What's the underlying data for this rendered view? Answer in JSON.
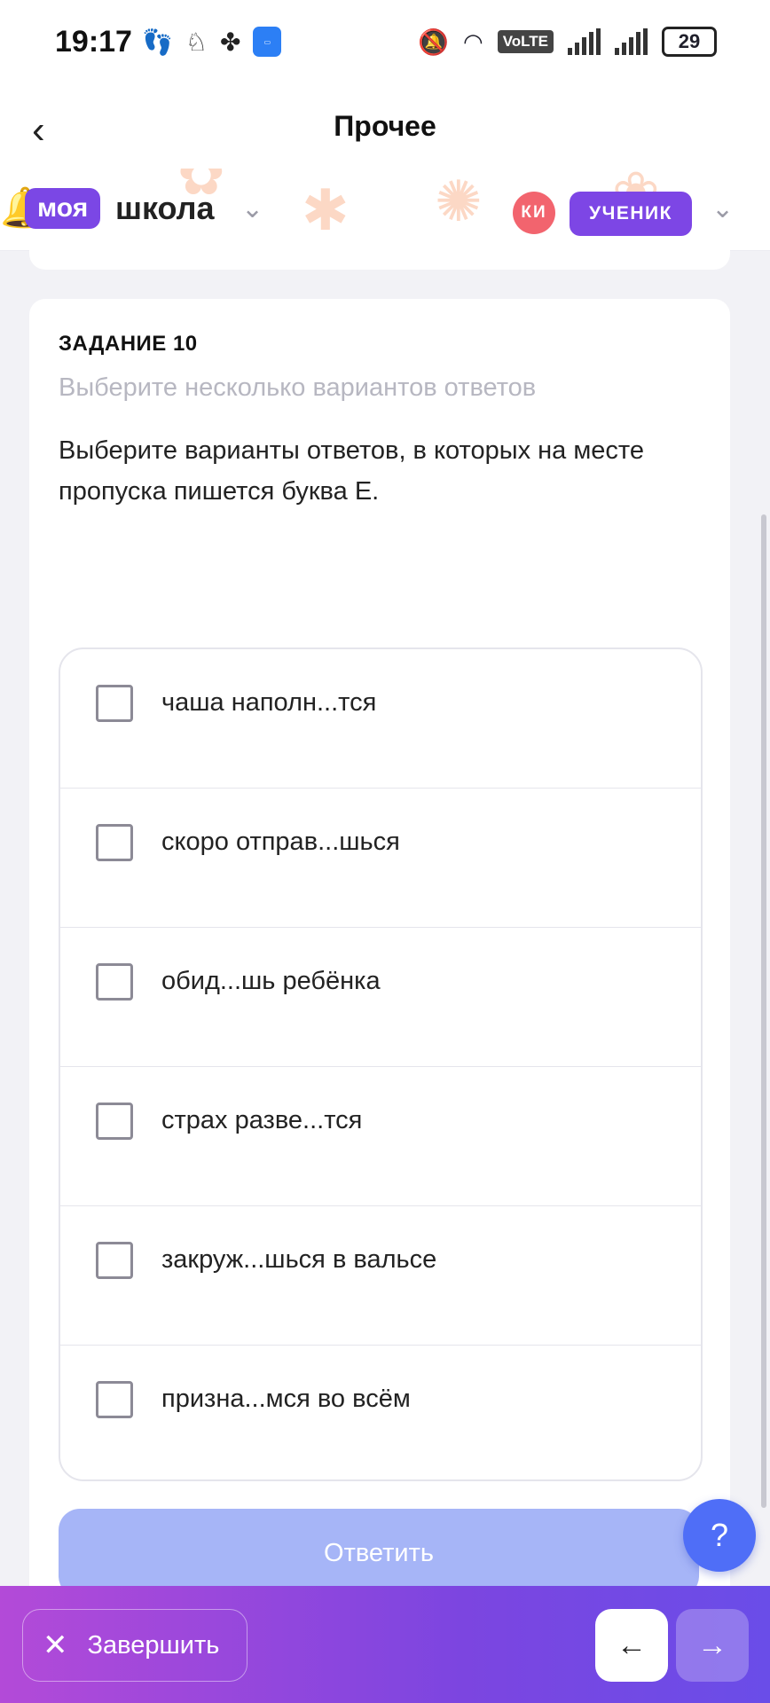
{
  "status": {
    "time": "19:17",
    "network": "VoLTE",
    "battery": "29"
  },
  "header": {
    "title": "Прочее"
  },
  "school": {
    "logo_part1": "моя",
    "logo_part2": "школа",
    "avatar_initials": "КИ",
    "role": "УЧЕНИК"
  },
  "task": {
    "label": "ЗАДАНИЕ 10",
    "hint": "Выберите несколько вариантов ответов",
    "question": "Выберите  варианты ответов, в которых на месте пропуска пишется буква Е.",
    "options": [
      {
        "text": "чаша наполн...тся",
        "checked": false
      },
      {
        "text": "скоро отправ...шься",
        "checked": false
      },
      {
        "text": "обид...шь ребёнка",
        "checked": false
      },
      {
        "text": "страх разве...тся",
        "checked": false
      },
      {
        "text": "закруж...шься в вальсе",
        "checked": false
      },
      {
        "text": "призна...мся во всём",
        "checked": false
      }
    ],
    "answer_label": "Ответить"
  },
  "help_label": "?",
  "footer": {
    "finish_label": "Завершить"
  },
  "colors": {
    "accent_purple": "#7b47e5",
    "answer_button": "#a6b5f7",
    "help_button": "#4f6ef7",
    "avatar": "#f2646e"
  }
}
